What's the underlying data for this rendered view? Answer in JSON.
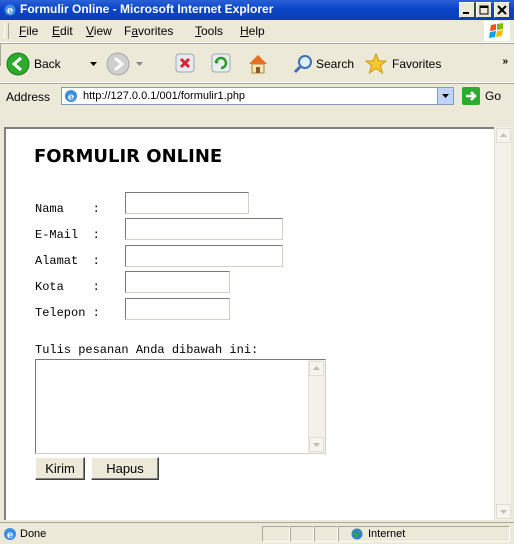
{
  "window": {
    "title": "Formulir Online - Microsoft Internet Explorer",
    "title_bar_color": "#0a44c7",
    "controls": [
      "minimize-icon",
      "maximize-icon",
      "close-icon"
    ]
  },
  "menu": {
    "items": [
      {
        "label": "File",
        "key": "F"
      },
      {
        "label": "Edit",
        "key": "E"
      },
      {
        "label": "View",
        "key": "V"
      },
      {
        "label": "Favorites",
        "key": "a"
      },
      {
        "label": "Tools",
        "key": "T"
      },
      {
        "label": "Help",
        "key": "H"
      }
    ]
  },
  "toolbar": {
    "back_label": "Back",
    "search_label": "Search",
    "favorites_label": "Favorites",
    "overflow": "»"
  },
  "address": {
    "label": "Address",
    "url": "http://127.0.0.1/001/formulir1.php",
    "go_label": "Go"
  },
  "page": {
    "heading": "FORMULIR ONLINE",
    "fields": [
      {
        "label": "Nama    :",
        "value": ""
      },
      {
        "label": "E-Mail  :",
        "value": ""
      },
      {
        "label": "Alamat  :",
        "value": ""
      },
      {
        "label": "Kota    :",
        "value": ""
      },
      {
        "label": "Telepon :",
        "value": ""
      }
    ],
    "message_label": "Tulis pesanan Anda dibawah ini:",
    "message_value": "",
    "submit_label": "Kirim",
    "reset_label": "Hapus"
  },
  "status": {
    "text": "Done",
    "zone": "Internet"
  }
}
